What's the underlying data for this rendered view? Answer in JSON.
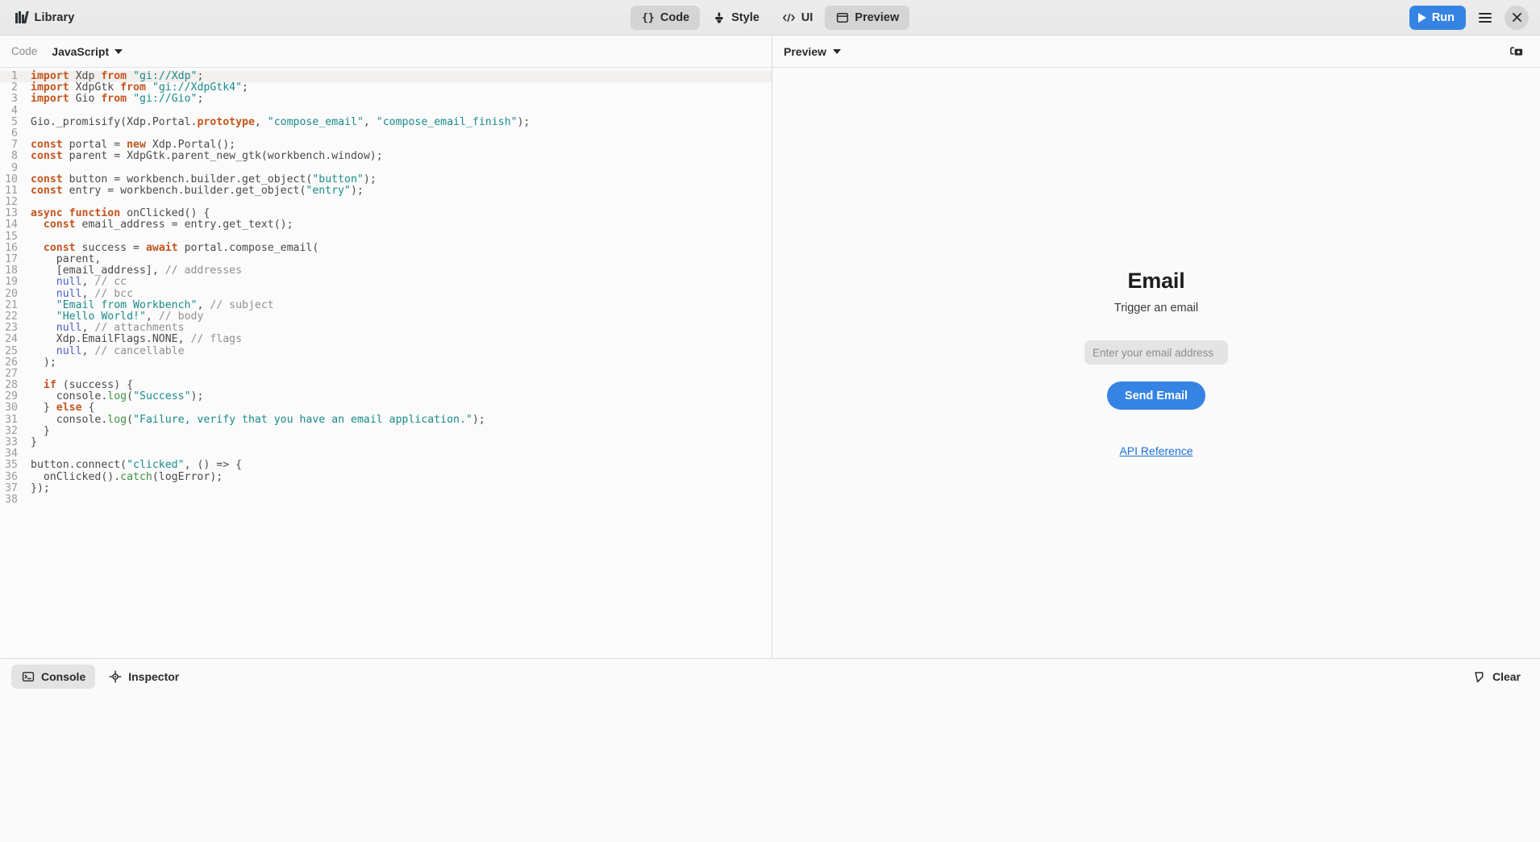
{
  "header": {
    "app_title": "Library",
    "app_icon": "library-books-icon",
    "tabs": [
      {
        "label": "Code",
        "icon": "braces-icon",
        "active": true
      },
      {
        "label": "Style",
        "icon": "brush-icon",
        "active": false
      },
      {
        "label": "UI",
        "icon": "code-tags-icon",
        "active": false
      },
      {
        "label": "Preview",
        "icon": "window-icon",
        "active": true
      }
    ],
    "run_label": "Run",
    "run_icon": "play-icon",
    "menu_icon": "hamburger-menu-icon",
    "close_icon": "close-icon",
    "accent_color": "#3584e4"
  },
  "code_panel": {
    "toolbar_label": "Code",
    "language": "JavaScript",
    "language_caret": "chevron-down-icon",
    "lines": [
      {
        "n": 1,
        "html": "<span class=\"t-kw\">import</span> Xdp <span class=\"t-kw\">from</span> <span class=\"t-str\">\"gi://Xdp\"</span>;",
        "current": true
      },
      {
        "n": 2,
        "html": "<span class=\"t-kw\">import</span> XdpGtk <span class=\"t-kw\">from</span> <span class=\"t-str\">\"gi://XdpGtk4\"</span>;"
      },
      {
        "n": 3,
        "html": "<span class=\"t-kw\">import</span> Gio <span class=\"t-kw\">from</span> <span class=\"t-str\">\"gi://Gio\"</span>;"
      },
      {
        "n": 4,
        "html": ""
      },
      {
        "n": 5,
        "html": "Gio._promisify(Xdp.Portal.<span class=\"t-prop\">prototype</span>, <span class=\"t-str\">\"compose_email\"</span>, <span class=\"t-str\">\"compose_email_finish\"</span>);"
      },
      {
        "n": 6,
        "html": ""
      },
      {
        "n": 7,
        "html": "<span class=\"t-kw\">const</span> portal = <span class=\"t-kw\">new</span> Xdp.Portal();"
      },
      {
        "n": 8,
        "html": "<span class=\"t-kw\">const</span> parent = XdpGtk.parent_new_gtk(workbench.window);"
      },
      {
        "n": 9,
        "html": ""
      },
      {
        "n": 10,
        "html": "<span class=\"t-kw\">const</span> button = workbench.builder.get_object(<span class=\"t-str\">\"button\"</span>);"
      },
      {
        "n": 11,
        "html": "<span class=\"t-kw\">const</span> entry = workbench.builder.get_object(<span class=\"t-str\">\"entry\"</span>);"
      },
      {
        "n": 12,
        "html": ""
      },
      {
        "n": 13,
        "html": "<span class=\"t-kw\">async function</span> onClicked() {"
      },
      {
        "n": 14,
        "html": "  <span class=\"t-kw\">const</span> email_address = entry.get_text();"
      },
      {
        "n": 15,
        "html": ""
      },
      {
        "n": 16,
        "html": "  <span class=\"t-kw\">const</span> success = <span class=\"t-kw\">await</span> portal.compose_email("
      },
      {
        "n": 17,
        "html": "    parent,"
      },
      {
        "n": 18,
        "html": "    [email_address], <span class=\"t-cmt\">// addresses</span>"
      },
      {
        "n": 19,
        "html": "    <span class=\"t-null\">null</span>, <span class=\"t-cmt\">// cc</span>"
      },
      {
        "n": 20,
        "html": "    <span class=\"t-null\">null</span>, <span class=\"t-cmt\">// bcc</span>"
      },
      {
        "n": 21,
        "html": "    <span class=\"t-str\">\"Email from Workbench\"</span>, <span class=\"t-cmt\">// subject</span>"
      },
      {
        "n": 22,
        "html": "    <span class=\"t-str\">\"Hello World!\"</span>, <span class=\"t-cmt\">// body</span>"
      },
      {
        "n": 23,
        "html": "    <span class=\"t-null\">null</span>, <span class=\"t-cmt\">// attachments</span>"
      },
      {
        "n": 24,
        "html": "    Xdp.EmailFlags.NONE, <span class=\"t-cmt\">// flags</span>"
      },
      {
        "n": 25,
        "html": "    <span class=\"t-null\">null</span>, <span class=\"t-cmt\">// cancellable</span>"
      },
      {
        "n": 26,
        "html": "  );"
      },
      {
        "n": 27,
        "html": ""
      },
      {
        "n": 28,
        "html": "  <span class=\"t-kw\">if</span> (success) {"
      },
      {
        "n": 29,
        "html": "    console.<span class=\"t-fn\">log</span>(<span class=\"t-str\">\"Success\"</span>);"
      },
      {
        "n": 30,
        "html": "  } <span class=\"t-kw\">else</span> {"
      },
      {
        "n": 31,
        "html": "    console.<span class=\"t-fn\">log</span>(<span class=\"t-str\">\"Failure, verify that you have an email application.\"</span>);"
      },
      {
        "n": 32,
        "html": "  }"
      },
      {
        "n": 33,
        "html": "}"
      },
      {
        "n": 34,
        "html": ""
      },
      {
        "n": 35,
        "html": "button.connect(<span class=\"t-str\">\"clicked\"</span>, () =&gt; {"
      },
      {
        "n": 36,
        "html": "  onClicked().<span class=\"t-fn\">catch</span>(logError);"
      },
      {
        "n": 37,
        "html": "});"
      },
      {
        "n": 38,
        "html": ""
      }
    ]
  },
  "preview_panel": {
    "toolbar_label": "Preview",
    "toolbar_caret": "chevron-down-icon",
    "screenshot_icon": "screenshot-camera-icon",
    "demo": {
      "title": "Email",
      "subtitle": "Trigger an email",
      "entry_value": "",
      "entry_placeholder": "Enter your email address",
      "button_label": "Send Email",
      "link_label": "API Reference"
    }
  },
  "bottom_bar": {
    "tabs": [
      {
        "label": "Console",
        "icon": "terminal-icon",
        "active": true
      },
      {
        "label": "Inspector",
        "icon": "crosshair-icon",
        "active": false
      }
    ],
    "clear_label": "Clear",
    "clear_icon": "eraser-icon"
  }
}
